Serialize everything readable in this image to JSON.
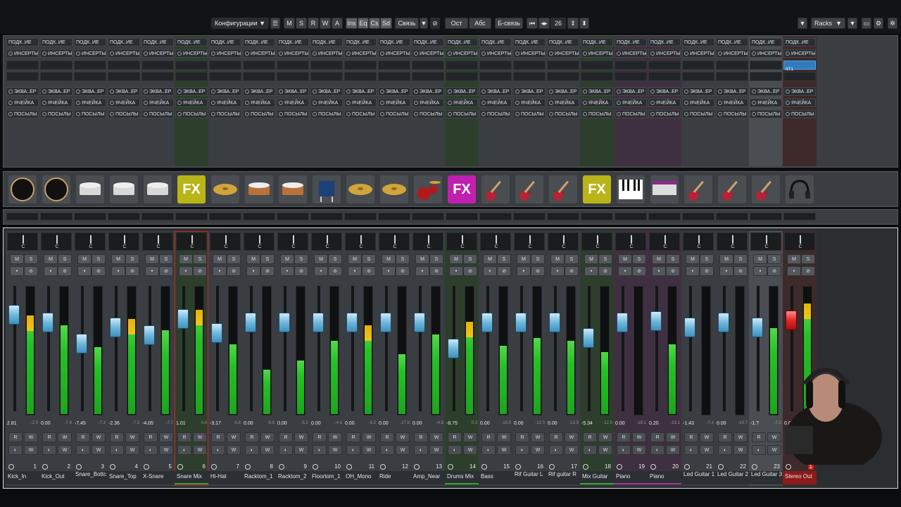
{
  "toolbar": {
    "config_label": "Конфигурации",
    "config_arrow": "▼",
    "m_label": "M",
    "s_label": "S",
    "r_label": "R",
    "w_label": "W",
    "a_label": "A",
    "ins_label": "Ins",
    "eq_label": "Eq",
    "cs_label": "Cs",
    "sd_label": "Sd",
    "link_label": "Связь",
    "link_arrow": "▼",
    "rel_label": "Ост",
    "abs_label": "Абс",
    "blink_label": "Б-связь",
    "count_value": "26",
    "racks_label": "Racks",
    "racks_arrow": "▼",
    "colors": {
      "button": "#3e4145",
      "bar": "#121314"
    }
  },
  "rack": {
    "subgroup_label": "ПОДК..ИЕ",
    "inserts_label": "ИНСЕРТЫ",
    "eq_label": "ЭКВА..ЕР",
    "cell_label": "ЯЧЕЙКА",
    "sends_label": "ПОСЫЛЫ",
    "insert_slot_selected": "ST1"
  },
  "picture_icons": [
    "bass-drum-icon",
    "kick-drum-icon",
    "snare-icon",
    "snare-icon",
    "snare-top-icon",
    "fx-tile",
    "cymbal-icon",
    "tom-icon",
    "tom-icon",
    "floor-tom-icon",
    "cymbal-icon",
    "cymbal-icon",
    "drum-kit-icon",
    "fx-tile",
    "guitar-icon",
    "guitar-icon",
    "guitar-icon",
    "fx-tile",
    "piano-icon",
    "keyboard-icon",
    "guitar-icon",
    "guitar-icon",
    "guitar-icon",
    "headphones-icon"
  ],
  "fx_text": "FX",
  "channels": [
    {
      "num": "1",
      "name": "Kick_In",
      "value": "2.81",
      "peak": "-2.0",
      "color": "#3a3d41",
      "fader": 0.82,
      "meter": 0.78,
      "peakm": 0.78
    },
    {
      "num": "2",
      "name": "Kick_Out",
      "value": "0.00",
      "peak": "-7.8",
      "color": "#3a3d41",
      "fader": 0.75,
      "meter": 0.7,
      "peakm": 0
    },
    {
      "num": "3",
      "name": "Snare_Bottc",
      "value": "-7.45",
      "peak": "-7.3",
      "color": "#3a3d41",
      "fader": 0.55,
      "meter": 0.53,
      "peakm": 0
    },
    {
      "num": "4",
      "name": "Snare_Top",
      "value": "-2.36",
      "peak": "-7.3",
      "color": "#3a3d41",
      "fader": 0.7,
      "meter": 0.75,
      "peakm": 0.75
    },
    {
      "num": "5",
      "name": "X-Snare",
      "value": "-4.05",
      "peak": "-7.7",
      "color": "#3a3d41",
      "fader": 0.63,
      "meter": 0.66,
      "peakm": 0
    },
    {
      "num": "6",
      "name": "Snare Mix",
      "value": "1.01",
      "peak": "0.4",
      "color": "#2d3f2c",
      "fader": 0.78,
      "meter": 0.82,
      "peakm": 0.82,
      "selected": true
    },
    {
      "num": "7",
      "name": "Hi-Hat",
      "value": "-3.17",
      "peak": "-6.8",
      "color": "#3a3d41",
      "fader": 0.65,
      "meter": 0.55,
      "peakm": 0
    },
    {
      "num": "8",
      "name": "Racktom_1",
      "value": "0.00",
      "peak": "-6.9",
      "color": "#3a3d41",
      "fader": 0.75,
      "meter": 0.35,
      "peakm": 0
    },
    {
      "num": "9",
      "name": "Racktom_2",
      "value": "0.00",
      "peak": "-5.2",
      "color": "#3a3d41",
      "fader": 0.75,
      "meter": 0.42,
      "peakm": 0
    },
    {
      "num": "10",
      "name": "Floortom_1",
      "value": "0.00",
      "peak": "-4.6",
      "color": "#3a3d41",
      "fader": 0.75,
      "meter": 0.58,
      "peakm": 0
    },
    {
      "num": "11",
      "name": "OH_Mono",
      "value": "0.00",
      "peak": "-8.2",
      "color": "#3a3d41",
      "fader": 0.75,
      "meter": 0.7,
      "peakm": 0.7
    },
    {
      "num": "12",
      "name": "Ride",
      "value": "0.00",
      "peak": "-17.8",
      "color": "#3a3d41",
      "fader": 0.75,
      "meter": 0.47,
      "peakm": 0
    },
    {
      "num": "13",
      "name": "Amp_Near",
      "value": "0.00",
      "peak": "-4.8",
      "color": "#3a3d41",
      "fader": 0.75,
      "meter": 0.63,
      "peakm": 0
    },
    {
      "num": "14",
      "name": "Drums Mix",
      "value": "-8.75",
      "peak": "0.3",
      "color": "#2d3f2c",
      "fader": 0.5,
      "meter": 0.73,
      "peakm": 0.73
    },
    {
      "num": "15",
      "name": "Bass",
      "value": "0.00",
      "peak": "-18.5",
      "color": "#3a3d41",
      "fader": 0.75,
      "meter": 0.54,
      "peakm": 0
    },
    {
      "num": "16",
      "name": "Rif Guitar L",
      "value": "0.00",
      "peak": "-12.0",
      "color": "#3a3d41",
      "fader": 0.75,
      "meter": 0.6,
      "peakm": 0
    },
    {
      "num": "17",
      "name": "Rif guitar R",
      "value": "0.00",
      "peak": "-13.9",
      "color": "#3a3d41",
      "fader": 0.75,
      "meter": 0.58,
      "peakm": 0
    },
    {
      "num": "18",
      "name": "Mix Guitar",
      "value": "-5.34",
      "peak": "-12.0",
      "color": "#2d3f2c",
      "fader": 0.6,
      "meter": 0.49,
      "peakm": 0
    },
    {
      "num": "19",
      "name": "Piano",
      "value": "0.00",
      "peak": "-18.1",
      "color": "#3f3041",
      "fader": 0.75,
      "meter": 0,
      "peakm": 0
    },
    {
      "num": "20",
      "name": "Piano",
      "value": "0.20",
      "peak": "-13.1",
      "color": "#3f3041",
      "fader": 0.76,
      "meter": 0.55,
      "peakm": 0
    },
    {
      "num": "21",
      "name": "Led Guitar 1",
      "value": "-1.43",
      "peak": "-7.4",
      "color": "#3a3d41",
      "fader": 0.7,
      "meter": 0,
      "peakm": 0
    },
    {
      "num": "22",
      "name": "Led Guitar 2",
      "value": "0.00",
      "peak": "-10.7",
      "color": "#3a3d41",
      "fader": 0.75,
      "meter": 0,
      "peakm": 0
    },
    {
      "num": "23",
      "name": "Led Guitar 3",
      "value": "-1.?",
      "peak": "-7.2",
      "color": "#4a4d51",
      "fader": 0.7,
      "meter": 0.68,
      "peakm": 0
    },
    {
      "num": "1",
      "name": "Stereo Out",
      "value": "0.00",
      "peak": "",
      "color": "#3e2a2a",
      "fader": 0.77,
      "meter": 0.87,
      "peakm": 0.87,
      "output": true
    }
  ]
}
